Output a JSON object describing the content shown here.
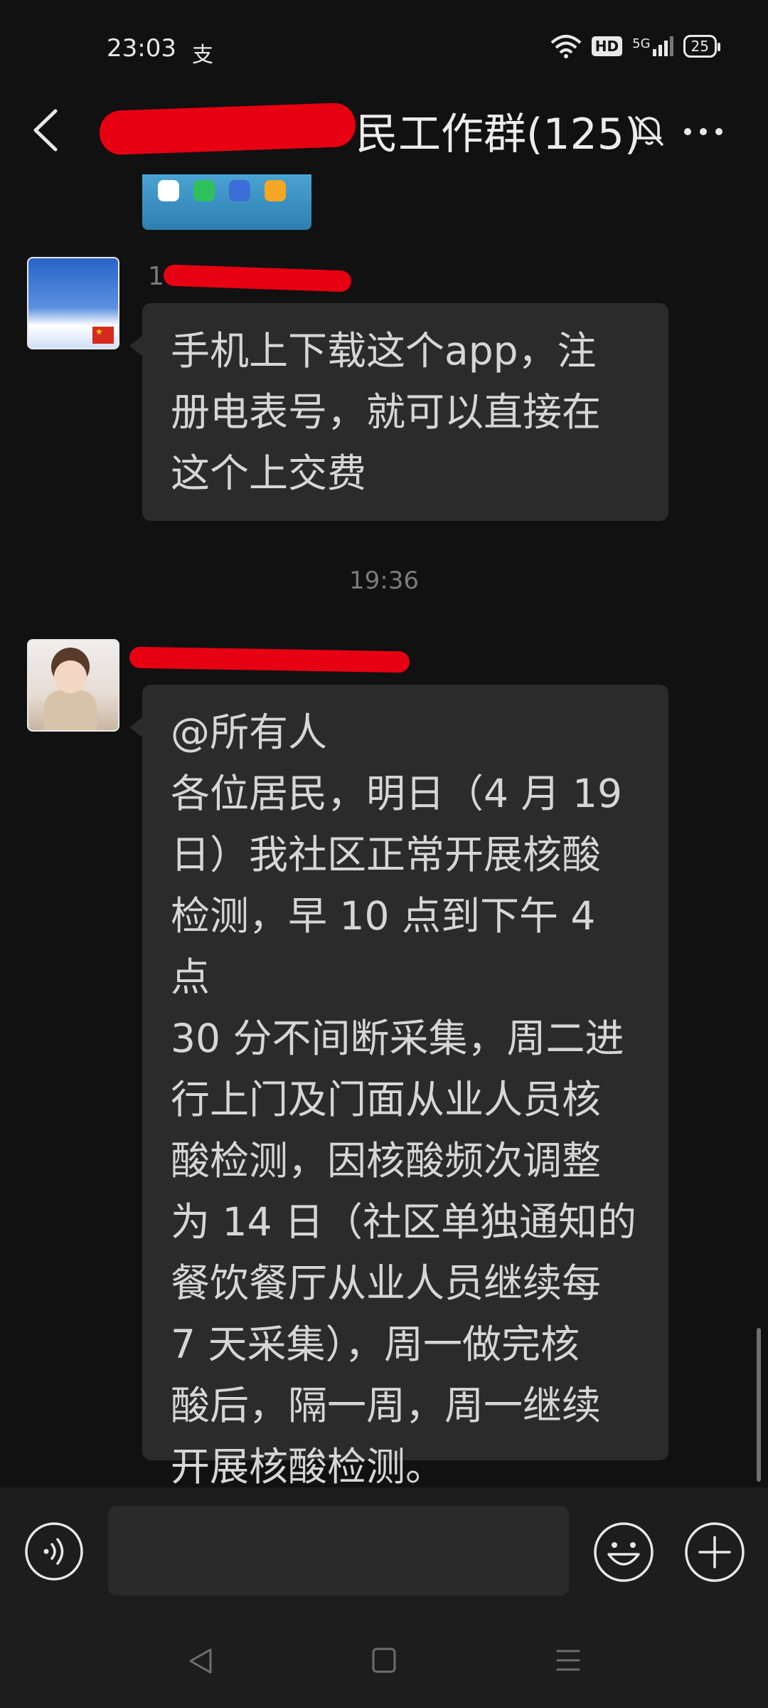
{
  "status_bar": {
    "time": "23:03",
    "app_icon_glyph": "支",
    "hd_label": "HD",
    "network_label": "5G",
    "battery_level": "25"
  },
  "header": {
    "title_visible": "民工作群(125)",
    "icons": [
      "back-icon",
      "bell-off-icon",
      "more-icon"
    ]
  },
  "messages": [
    {
      "sender_visible": "1",
      "text": "手机上下载这个app，注\n册电表号，就可以直接在\n这个上交费"
    },
    {
      "sender_visible": "",
      "text": "@所有人\n各位居民，明日（4 月 19\n日）我社区正常开展核酸\n检测，早 10 点到下午 4 点\n30 分不间断采集，周二进\n行上门及门面从业人员核\n酸检测，因核酸频次调整\n为 14 日（社区单独通知的\n餐饮餐厅从业人员继续每\n7 天采集），周一做完核\n酸后，隔一周，周一继续\n开展核酸检测。"
    }
  ],
  "timestamp": "19:36",
  "input": {
    "placeholder": "",
    "value": ""
  },
  "colors": {
    "background": "#111111",
    "bubble": "#2b2b2b",
    "redaction": "#e60012",
    "text": "#d6d6d6"
  }
}
